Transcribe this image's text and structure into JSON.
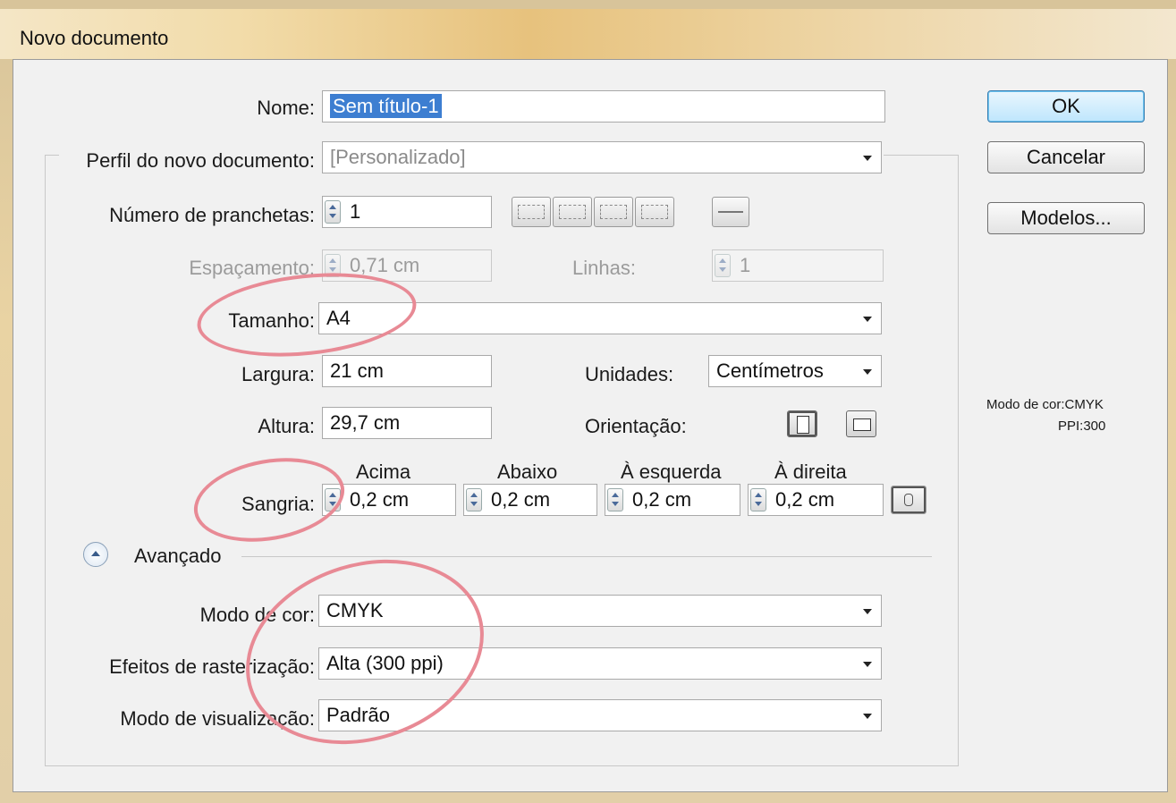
{
  "dialog": {
    "title": "Novo documento"
  },
  "form": {
    "nome": {
      "label": "Nome:",
      "value": "Sem título-1"
    },
    "perfil": {
      "label": "Perfil do novo documento:",
      "value": "[Personalizado]"
    },
    "pranchetas": {
      "label": "Número de pranchetas:",
      "value": "1"
    },
    "espacamento": {
      "label": "Espaçamento:",
      "value": "0,71 cm"
    },
    "linhas": {
      "label": "Linhas:",
      "value": "1"
    },
    "tamanho": {
      "label": "Tamanho:",
      "value": "A4"
    },
    "largura": {
      "label": "Largura:",
      "value": "21 cm"
    },
    "altura": {
      "label": "Altura:",
      "value": "29,7 cm"
    },
    "unidades": {
      "label": "Unidades:",
      "value": "Centímetros"
    },
    "orientacao": {
      "label": "Orientação:"
    },
    "sangria": {
      "label": "Sangria:",
      "headers": [
        "Acima",
        "Abaixo",
        "À esquerda",
        "À direita"
      ],
      "values": [
        "0,2 cm",
        "0,2 cm",
        "0,2 cm",
        "0,2 cm"
      ]
    },
    "avancado": {
      "label": "Avançado"
    },
    "modo_cor": {
      "label": "Modo de cor:",
      "value": "CMYK"
    },
    "rasterizacao": {
      "label": "Efeitos de rasterização:",
      "value": "Alta (300 ppi)"
    },
    "visualizacao": {
      "label": "Modo de visualização:",
      "value": "Padrão"
    }
  },
  "buttons": {
    "ok": "OK",
    "cancelar": "Cancelar",
    "modelos": "Modelos..."
  },
  "info": {
    "line1": "Modo de cor:CMYK",
    "line2": "PPI:300"
  },
  "colors": {
    "annotation_circle": "#e88a95",
    "default_button": "#bee6fd"
  }
}
